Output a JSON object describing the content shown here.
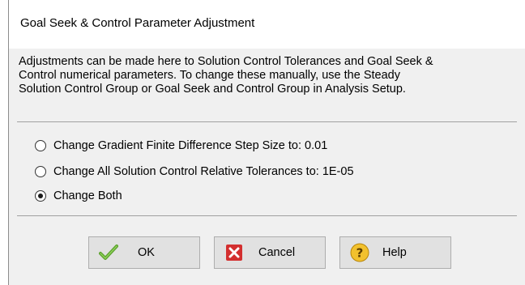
{
  "dialog": {
    "title": "Goal Seek & Control Parameter Adjustment",
    "description_lines": [
      "Adjustments can be made here to Solution Control Tolerances and Goal Seek &",
      "Control numerical parameters. To change these manually, use the Steady",
      "Solution Control Group or Goal Seek and Control Group in Analysis Setup."
    ],
    "options": [
      {
        "label": "Change Gradient Finite Difference Step Size to: 0.01",
        "selected": false
      },
      {
        "label": "Change All Solution Control Relative Tolerances to: 1E-05",
        "selected": false
      },
      {
        "label": "Change Both",
        "selected": true
      }
    ],
    "buttons": {
      "ok": {
        "label": "OK",
        "icon": "checkmark-icon"
      },
      "cancel": {
        "label": "Cancel",
        "icon": "close-icon"
      },
      "help": {
        "label": "Help",
        "icon": "help-icon"
      }
    },
    "colors": {
      "ok_check": "#5aa02c",
      "cancel_red": "#d32f2f",
      "help_yellow": "#f2c12e"
    }
  }
}
